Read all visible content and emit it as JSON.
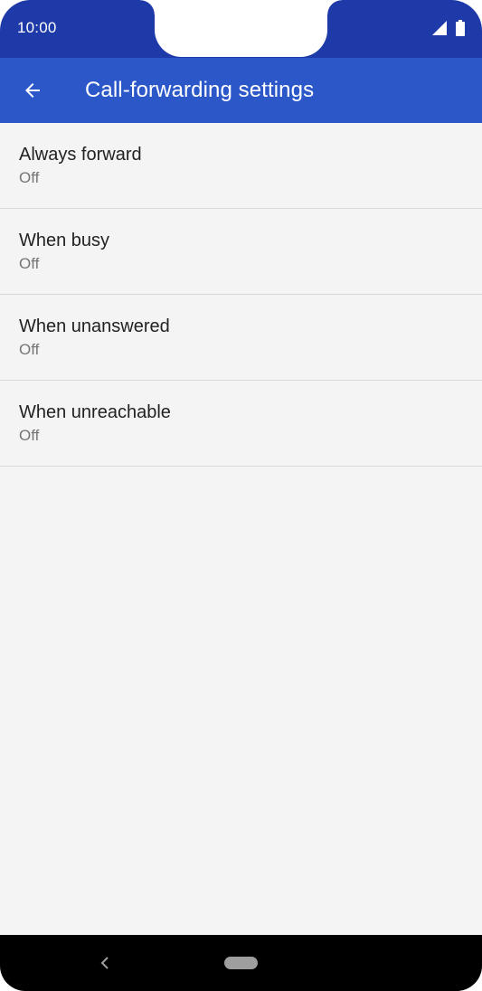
{
  "status_bar": {
    "time": "10:00",
    "signal_icon": "cellular-signal-icon",
    "battery_icon": "battery-icon"
  },
  "app_bar": {
    "back_icon": "arrow-back-icon",
    "title": "Call-forwarding settings"
  },
  "settings": [
    {
      "title": "Always forward",
      "summary": "Off"
    },
    {
      "title": "When busy",
      "summary": "Off"
    },
    {
      "title": "When unanswered",
      "summary": "Off"
    },
    {
      "title": "When unreachable",
      "summary": "Off"
    }
  ],
  "nav_bar": {
    "back_icon": "nav-back-chevron-icon",
    "home_icon": "home-pill-icon"
  },
  "colors": {
    "status_bar": "#1e3aa8",
    "app_bar": "#2b57c9",
    "background": "#f4f4f4",
    "primary_text": "#222222",
    "secondary_text": "#757575",
    "divider": "#d8d8d8",
    "nav_bar": "#000000"
  }
}
